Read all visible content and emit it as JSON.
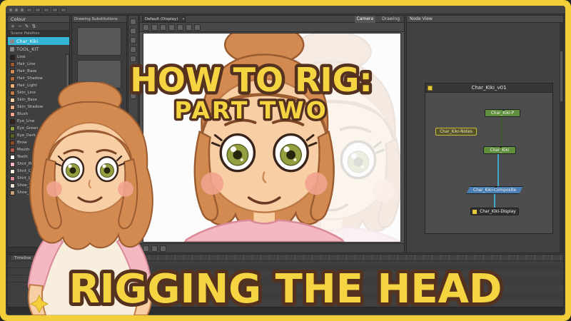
{
  "overlay": {
    "line1": "HOW TO RIG:",
    "line2": "PART TWO",
    "bottom_line": "RIGGING THE HEAD",
    "text_color": "#f5d441",
    "outline_color": "#54321f"
  },
  "palette_panel": {
    "tab_label": "Colour",
    "toolbar_icons": [
      "+",
      "−",
      "✎",
      "⇅"
    ],
    "section_label": "Scene Palettes",
    "palettes": [
      {
        "label": "Char_Kiki"
      },
      {
        "label": "TOOL_KIT"
      }
    ],
    "selected_palette": "Char_Kiki",
    "swatches": [
      {
        "name": "Line",
        "color": "#2b1f18"
      },
      {
        "name": "Hair_Line",
        "color": "#9a5a2c"
      },
      {
        "name": "Hair_Base",
        "color": "#d28a50"
      },
      {
        "name": "Hair_Shadow",
        "color": "#b06a38"
      },
      {
        "name": "Hair_Light",
        "color": "#e8ae74"
      },
      {
        "name": "Skin_Line",
        "color": "#bd7a46"
      },
      {
        "name": "Skin_Base",
        "color": "#f8cfa4"
      },
      {
        "name": "Skin_Shadow",
        "color": "#eaa87c"
      },
      {
        "name": "Blush",
        "color": "#f2a28e"
      },
      {
        "name": "Eye_Line",
        "color": "#3a2416"
      },
      {
        "name": "Eye_Green",
        "color": "#94a040"
      },
      {
        "name": "Eye_Dark",
        "color": "#5c6224"
      },
      {
        "name": "Brow",
        "color": "#8a4a28"
      },
      {
        "name": "Mouth",
        "color": "#b4584e"
      },
      {
        "name": "Teeth",
        "color": "#ffffff"
      },
      {
        "name": "Shirt_Pink",
        "color": "#f4b8c2"
      },
      {
        "name": "Shirt_Cream",
        "color": "#f7eedd"
      },
      {
        "name": "Shirt_Line",
        "color": "#d98a96"
      },
      {
        "name": "Shoe_Toe_Base",
        "color": "#e8e0d0"
      },
      {
        "name": "Shoe_Sole",
        "color": "#caa27a"
      }
    ]
  },
  "substitutions_panel": {
    "tab_label": "Drawing Substitutions"
  },
  "canvas": {
    "display_selector": "Default (Display)",
    "tabs": [
      {
        "label": "Camera"
      },
      {
        "label": "Drawing"
      }
    ]
  },
  "node_view": {
    "tab_label": "Node View",
    "group_title": "Char_Kiki_v01",
    "nodes": [
      {
        "label": "Char_Kiki-P",
        "color": "#5f8f3c"
      },
      {
        "label": "Char_Kiki-Notes",
        "color": "#55532a"
      },
      {
        "label": "Char_Kiki",
        "color": "#5f8f3c"
      },
      {
        "label": "Char_Kiki-Composite",
        "color": "#4b7fb4"
      },
      {
        "label": "Char_Kiki-Display",
        "color": "#2f2f2f"
      }
    ]
  },
  "timeline": {
    "tab_label": "Timeline"
  },
  "character": {
    "hair_color": "#d28a50",
    "skin_color": "#f8cfa4",
    "eye_color": "#94a040",
    "blush_color": "#f2a28e",
    "shirt_pink": "#f4b8c2",
    "shirt_cream": "#f7eedd"
  }
}
